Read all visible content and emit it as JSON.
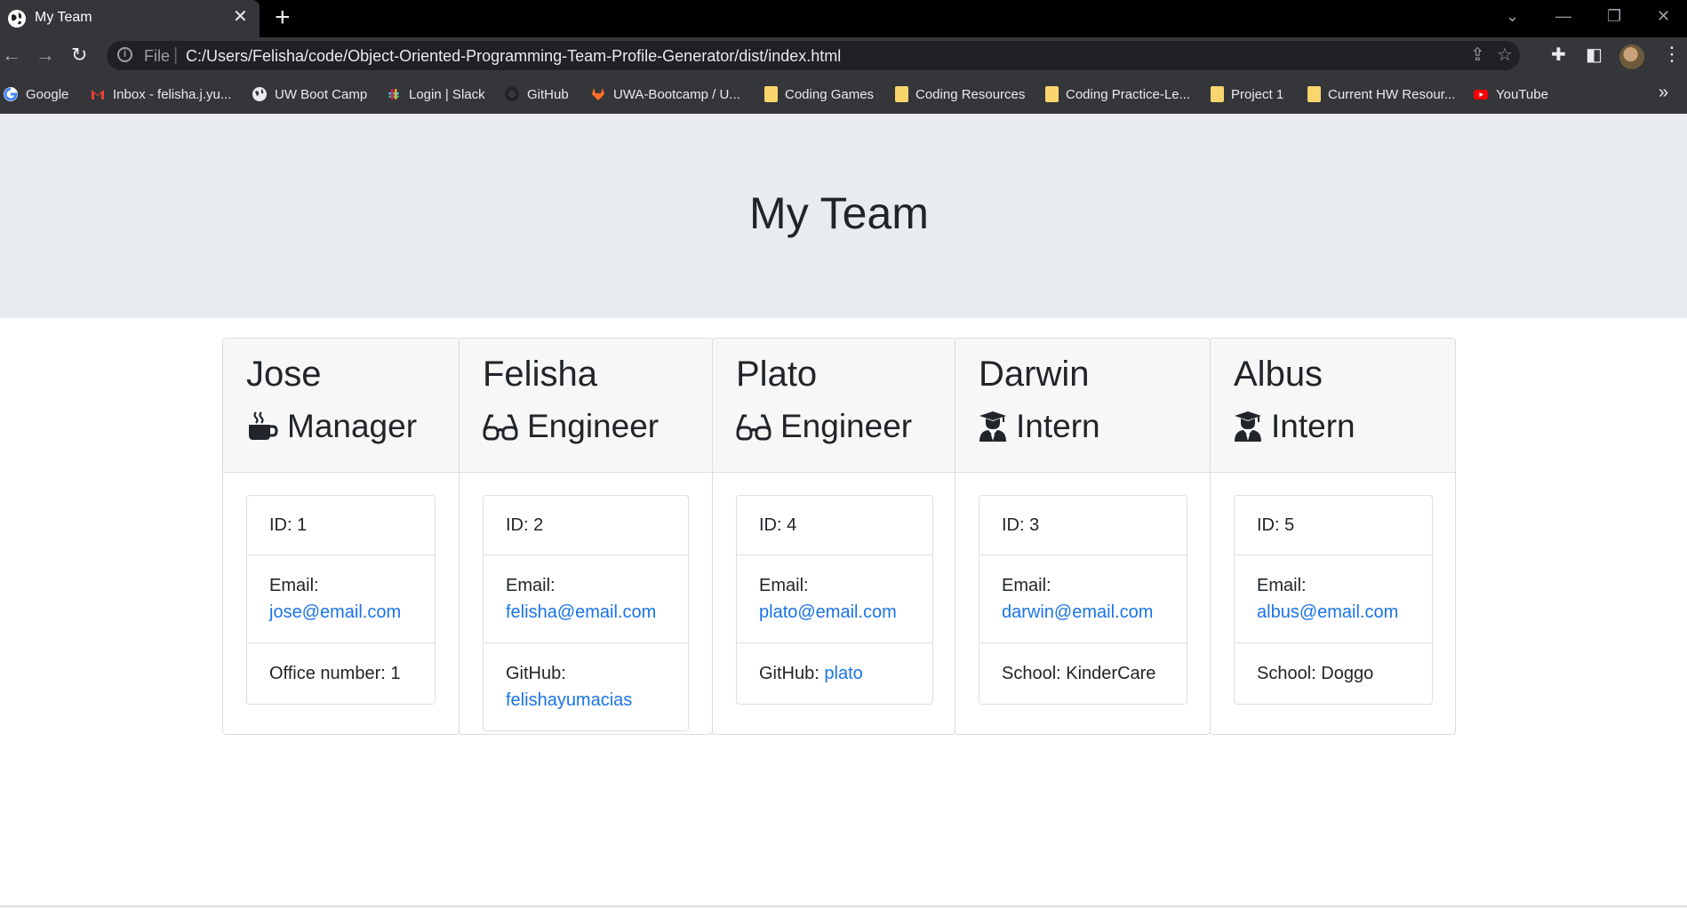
{
  "browser": {
    "tab_title": "My Team",
    "url_scheme": "File",
    "url": "C:/Users/Felisha/code/Object-Oriented-Programming-Team-Profile-Generator/dist/index.html",
    "bookmarks": [
      {
        "label": "Google",
        "icon": "google-icon"
      },
      {
        "label": "Inbox - felisha.j.yu...",
        "icon": "gmail-icon"
      },
      {
        "label": "UW Boot Camp",
        "icon": "globe-icon"
      },
      {
        "label": "Login | Slack",
        "icon": "slack-icon"
      },
      {
        "label": "GitHub",
        "icon": "github-icon"
      },
      {
        "label": "UWA-Bootcamp / U...",
        "icon": "gitlab-icon"
      },
      {
        "label": "Coding Games",
        "icon": "folder-icon"
      },
      {
        "label": "Coding Resources",
        "icon": "folder-icon"
      },
      {
        "label": "Coding Practice-Le...",
        "icon": "folder-icon"
      },
      {
        "label": "Project 1",
        "icon": "folder-icon"
      },
      {
        "label": "Current HW Resour...",
        "icon": "folder-icon"
      },
      {
        "label": "YouTube",
        "icon": "youtube-icon"
      }
    ]
  },
  "page": {
    "title": "My Team"
  },
  "team": [
    {
      "name": "Jose",
      "role": "Manager",
      "icon": "mug-icon",
      "id": "ID: 1",
      "email_label": "Email:",
      "email": "jose@email.com",
      "extra_label": "Office number: 1",
      "extra_link": ""
    },
    {
      "name": "Felisha",
      "role": "Engineer",
      "icon": "glasses-icon",
      "id": "ID: 2",
      "email_label": "Email:",
      "email": "felisha@email.com",
      "extra_label": "GitHub:",
      "extra_link": "felishayumacias"
    },
    {
      "name": "Plato",
      "role": "Engineer",
      "icon": "glasses-icon",
      "id": "ID: 4",
      "email_label": "Email:",
      "email": "plato@email.com",
      "extra_label": "GitHub:",
      "extra_link": "plato"
    },
    {
      "name": "Darwin",
      "role": "Intern",
      "icon": "graduate-icon",
      "id": "ID: 3",
      "email_label": "Email:",
      "email": "darwin@email.com",
      "extra_label": "School: KinderCare",
      "extra_link": ""
    },
    {
      "name": "Albus",
      "role": "Intern",
      "icon": "graduate-icon",
      "id": "ID: 5",
      "email_label": "Email:",
      "email": "albus@email.com",
      "extra_label": "School: Doggo",
      "extra_link": ""
    }
  ],
  "colors": {
    "link": "#1a73e8",
    "jumbotron": "#e9ecef",
    "card_header": "#f7f7f7"
  }
}
